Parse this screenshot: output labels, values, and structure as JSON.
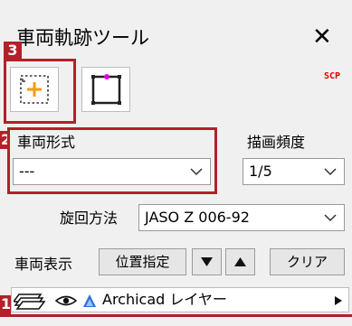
{
  "window": {
    "title": "車両軌跡ツール"
  },
  "callouts": {
    "n3": "3",
    "n2": "2",
    "n1": "1"
  },
  "tools": {
    "scp_label": "SCP"
  },
  "vehicle_type": {
    "label": "車両形式",
    "value": "---"
  },
  "draw_frequency": {
    "label": "描画頻度",
    "value": "1/5"
  },
  "turning_method": {
    "label": "旋回方法",
    "value": "JASO Z 006-92"
  },
  "vehicle_display": {
    "label": "車両表示",
    "position_button": "位置指定",
    "clear_button": "クリア"
  },
  "layer": {
    "name": "Archicad レイヤー"
  },
  "colors": {
    "callout_red": "#b3202a",
    "accent_orange": "#f39c12",
    "marker_magenta": "#e000e0"
  }
}
